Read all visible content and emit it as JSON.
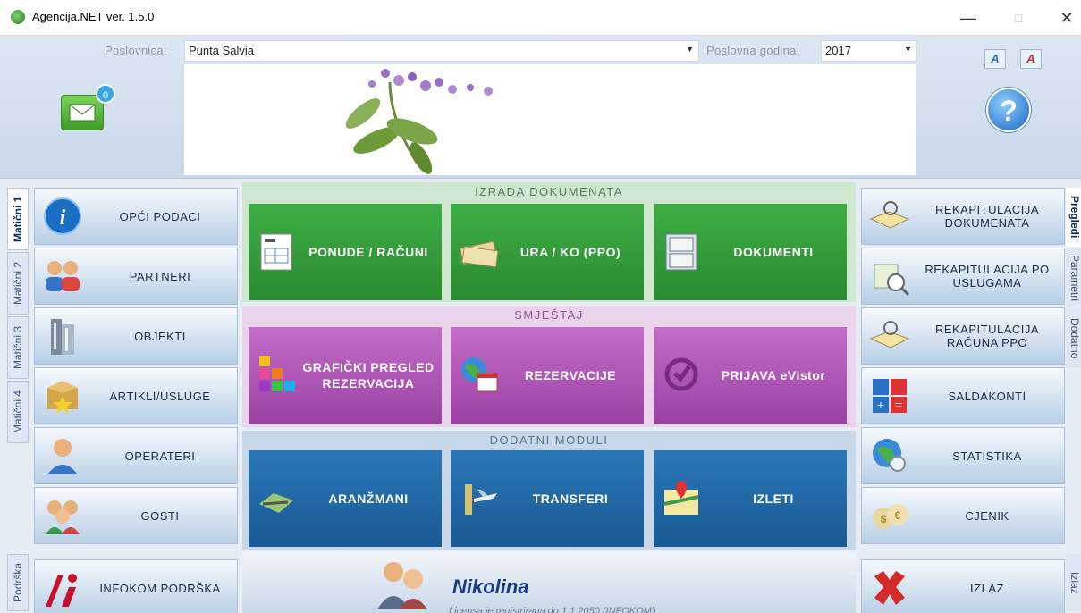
{
  "window": {
    "title": "Agencija.NET ver. 1.5.0",
    "minimize": "—",
    "maximize": "□",
    "close": "✕"
  },
  "header": {
    "poslovnica_label": "Poslovnica:",
    "poslovnica_value": "Punta Salvia",
    "godina_label": "Poslovna godina:",
    "godina_value": "2017",
    "mail_count": "0",
    "help": "?",
    "font_increase": "A",
    "font_decrease": "A"
  },
  "left_tabs": [
    "Matični 1",
    "Matični 2",
    "Matični 3",
    "Matični 4"
  ],
  "left_buttons": [
    "OPĆI PODACI",
    "PARTNERI",
    "OBJEKTI",
    "ARTIKLI/USLUGE",
    "OPERATERI",
    "GOSTI"
  ],
  "support_tab": "Podrška",
  "support_button": "INFOKOM PODRŠKA",
  "sections": {
    "docs": {
      "title": "IZRADA DOKUMENATA",
      "buttons": [
        "PONUDE / RAČUNI",
        "URA / KO (PPO)",
        "DOKUMENTI"
      ]
    },
    "accom": {
      "title": "SMJEŠTAJ",
      "buttons": [
        "GRAFIČKI PREGLED REZERVACIJA",
        "REZERVACIJE",
        "PRIJAVA eVistor"
      ]
    },
    "modules": {
      "title": "DODATNI MODULI",
      "buttons": [
        "ARANŽMANI",
        "TRANSFERI",
        "IZLETI"
      ]
    }
  },
  "user": {
    "name": "Nikolina",
    "license": "Licensa je registrirana do 1.1.2050 (INFOKOM)"
  },
  "right_tabs": [
    "Pregledi",
    "Parametri",
    "Dodatno"
  ],
  "exit_tab": "Izlaz",
  "right_buttons": [
    "REKAPITULACIJA DOKUMENATA",
    "REKAPITULACIJA PO USLUGAMA",
    "REKAPITULACIJA RAČUNA PPO",
    "SALDAKONTI",
    "STATISTIKA",
    "CJENIK"
  ],
  "exit_button": "IZLAZ"
}
